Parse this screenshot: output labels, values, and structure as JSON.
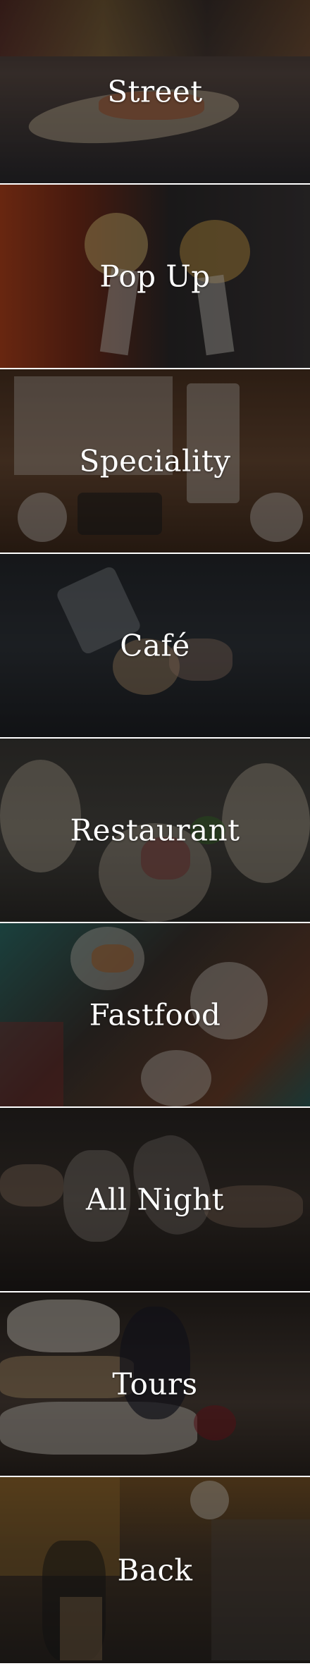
{
  "menu": {
    "items": [
      {
        "label": "Street"
      },
      {
        "label": "Pop Up"
      },
      {
        "label": "Speciality"
      },
      {
        "label": "Café"
      },
      {
        "label": "Restaurant"
      },
      {
        "label": "Fastfood"
      },
      {
        "label": "All Night"
      },
      {
        "label": "Tours"
      },
      {
        "label": "Back"
      }
    ]
  }
}
